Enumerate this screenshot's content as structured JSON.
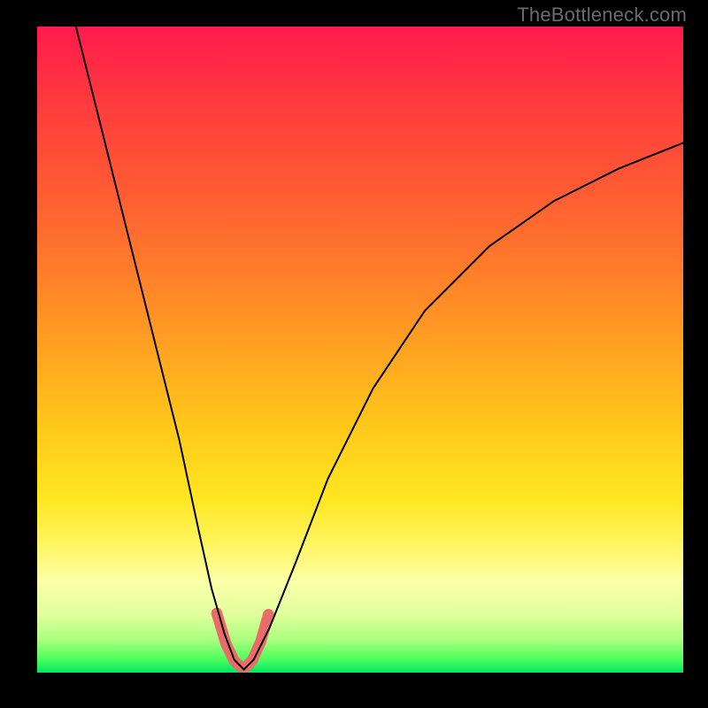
{
  "watermark": "TheBottleneck.com",
  "chart_data": {
    "type": "line",
    "title": "",
    "xlabel": "",
    "ylabel": "",
    "xlim": [
      0,
      100
    ],
    "ylim": [
      0,
      100
    ],
    "series": [
      {
        "name": "black-curve",
        "x": [
          6,
          10,
          14,
          18,
          22,
          25,
          27,
          29,
          30.5,
          32,
          33.5,
          36,
          40,
          45,
          52,
          60,
          70,
          80,
          90,
          100
        ],
        "y": [
          100,
          84,
          68,
          52,
          36,
          22,
          13,
          6,
          2,
          0.5,
          2,
          7,
          17,
          30,
          44,
          56,
          66,
          73,
          78,
          82
        ]
      },
      {
        "name": "pink-highlight",
        "x": [
          27.8,
          29.2,
          30.5,
          31.5,
          32.3,
          33.3,
          34.6,
          35.8
        ],
        "y": [
          9.2,
          4.5,
          1.8,
          0.9,
          0.9,
          1.9,
          4.8,
          9.0
        ]
      }
    ],
    "annotations": []
  }
}
